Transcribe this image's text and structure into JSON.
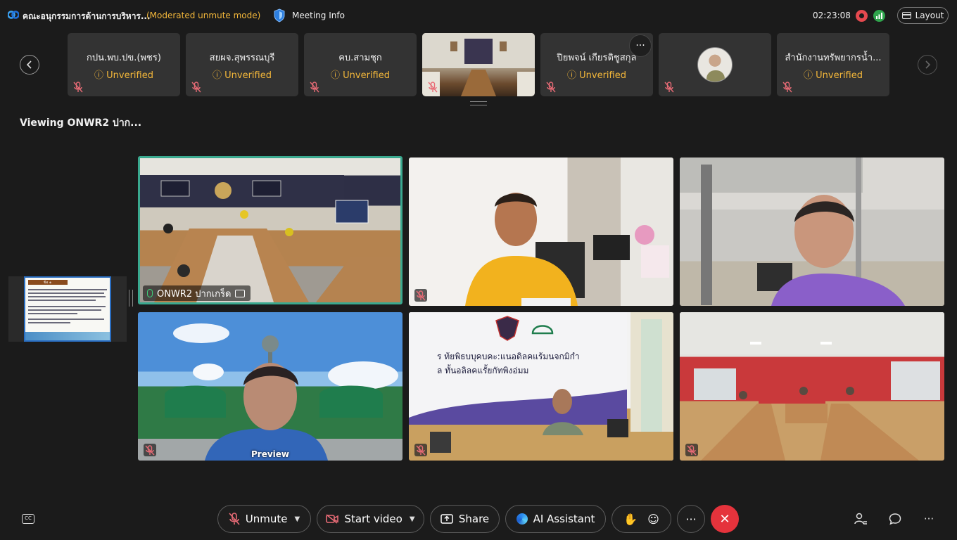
{
  "header": {
    "meeting_title": "คณะอนุกรรมการด้านการบริหาร...",
    "mode": "(Moderated unmute mode)",
    "meeting_info": "Meeting Info",
    "clock": "02:23:08",
    "layout_label": "Layout"
  },
  "filmstrip": {
    "tiles": [
      {
        "name": "กปน.พบ.ปข.(พชร)",
        "status": "Unverified"
      },
      {
        "name": "สยผจ.สุพรรณบุรี",
        "status": "Unverified"
      },
      {
        "name": "คบ.สามชุก",
        "status": "Unverified"
      },
      {
        "name": "ปิยพจน์ เกียรติชูสกุล",
        "status": "Unverified"
      },
      {
        "name": "สำนักงานทรัพยากรน้ำ...",
        "status": "Unverified"
      }
    ],
    "more_label": "···"
  },
  "viewing": "Viewing ONWR2 ปาก...",
  "share_doc_title": "ข้อ ๑",
  "grid": {
    "active_name": "ONWR2 ปากเกร็ด",
    "preview_label": "Preview",
    "banner_line1": "ร ท้ยพิธบบุคบคะ:แนอดิลคแร้มนจกมิกำ",
    "banner_line2": "ล ทั้นอลิลคแรั้ยกัทพิงอ่มม"
  },
  "controls": {
    "unmute": "Unmute",
    "start_video": "Start video",
    "share": "Share",
    "ai_assistant": "AI Assistant",
    "more": "···"
  },
  "colors": {
    "accent_warning": "#f3b73a",
    "active_border": "#3aa98f",
    "end_call": "#e5333c"
  }
}
